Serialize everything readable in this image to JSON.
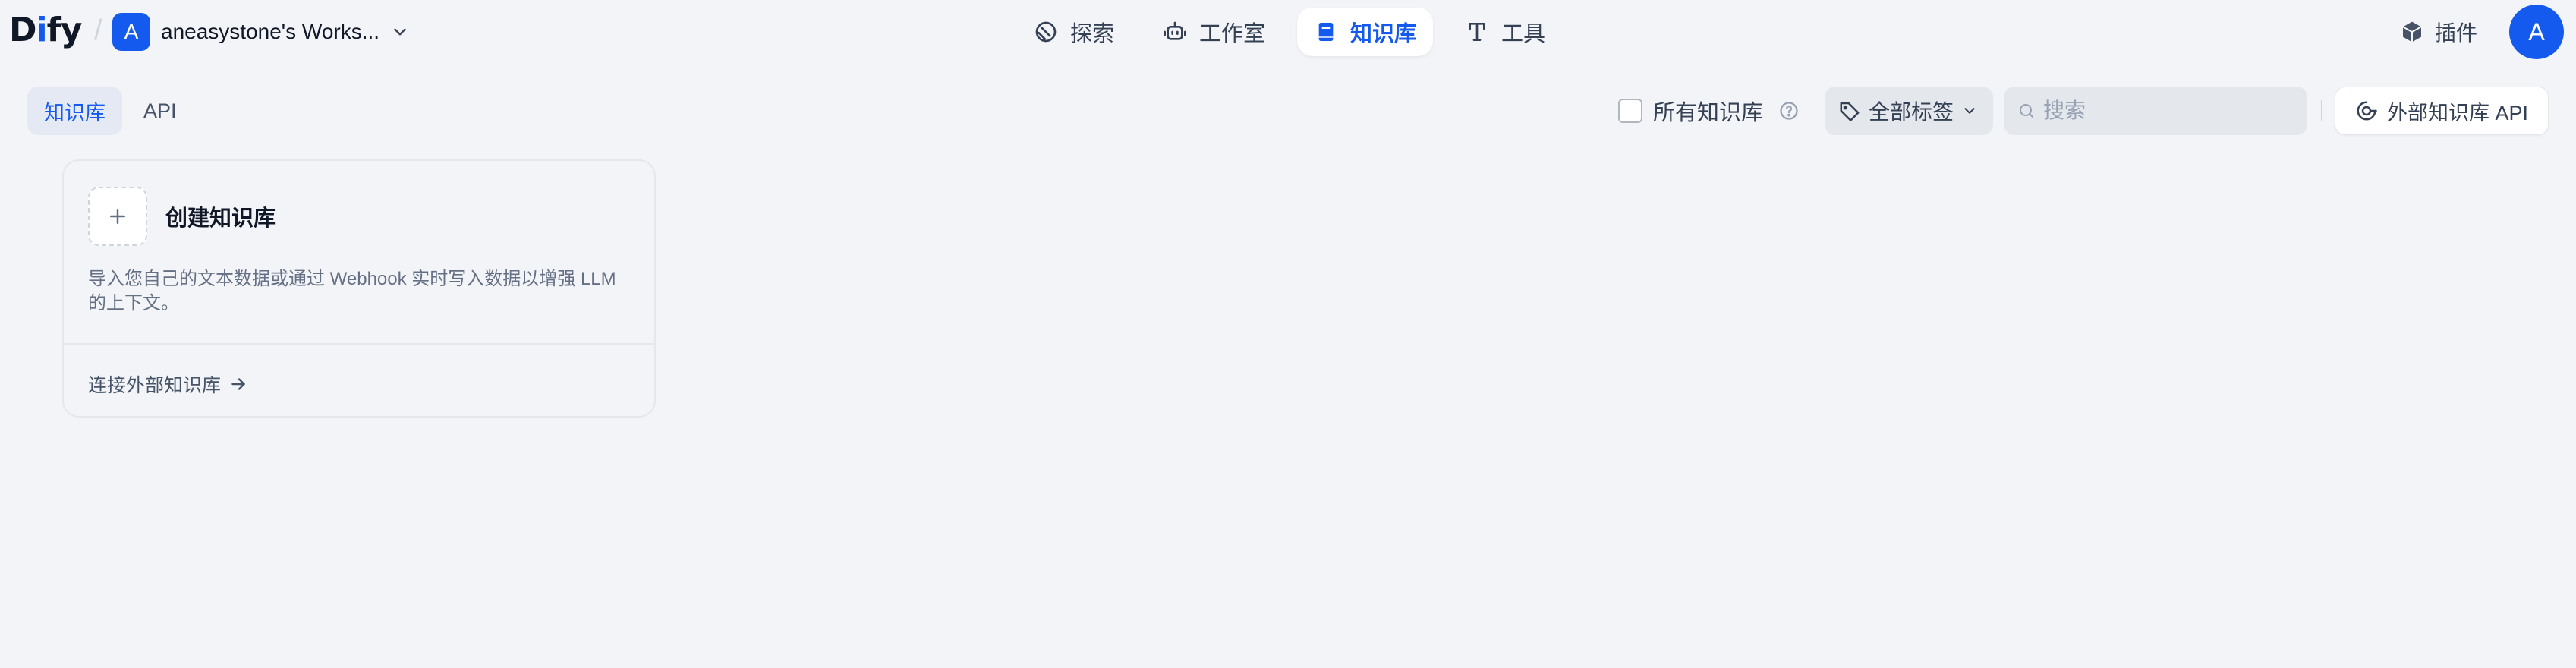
{
  "app": {
    "logo": "Dify",
    "workspace": {
      "avatar_letter": "A",
      "name": "aneasystone's Works..."
    }
  },
  "nav": [
    {
      "label": "探索",
      "icon": "explore-icon"
    },
    {
      "label": "工作室",
      "icon": "robot-icon"
    },
    {
      "label": "知识库",
      "icon": "book-icon",
      "active": true
    },
    {
      "label": "工具",
      "icon": "tool-icon"
    }
  ],
  "header_right": {
    "plugins_label": "插件",
    "user_avatar_letter": "A"
  },
  "tabs": [
    {
      "label": "知识库",
      "active": true
    },
    {
      "label": "API",
      "active": false
    }
  ],
  "filters": {
    "all_datasets_label": "所有知识库",
    "all_datasets_checked": false,
    "tag_label": "全部标签",
    "search_placeholder": "搜索",
    "search_value": "",
    "external_api_label": "外部知识库 API"
  },
  "create_card": {
    "title": "创建知识库",
    "description": "导入您自己的文本数据或通过 Webhook 实时写入数据以增强 LLM 的上下文。",
    "connect_label": "连接外部知识库"
  },
  "colors": {
    "accent": "#155aef",
    "background": "#f2f4f7"
  }
}
